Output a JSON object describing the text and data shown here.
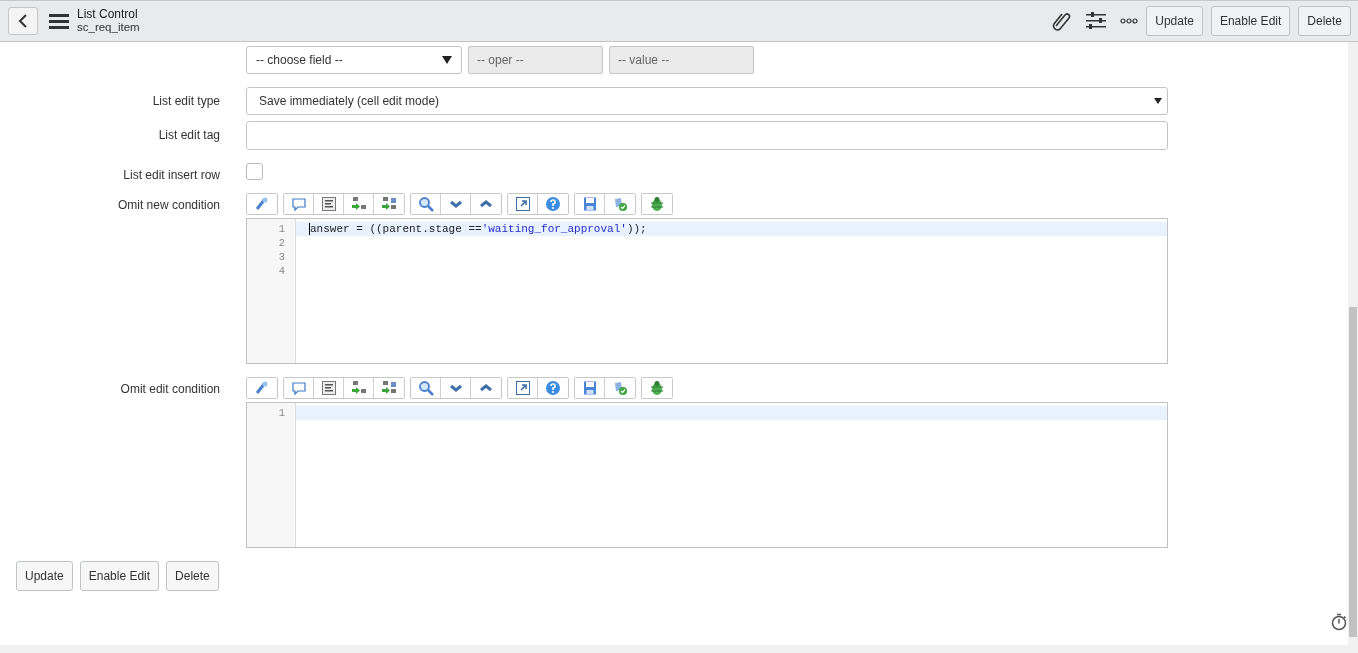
{
  "header": {
    "title": "List Control",
    "subtitle": "sc_req_item",
    "buttons": [
      "Update",
      "Enable Edit",
      "Delete"
    ]
  },
  "condition": {
    "field_placeholder": "-- choose field --",
    "oper_placeholder": "-- oper --",
    "value_placeholder": "-- value --"
  },
  "fields": [
    {
      "kind": "select",
      "label": "List edit type",
      "value": "Save immediately (cell edit mode)"
    },
    {
      "kind": "text",
      "label": "List edit tag"
    },
    {
      "kind": "checkbox",
      "label": "List edit insert row",
      "checked": false
    },
    {
      "kind": "script",
      "label": "Omit new condition",
      "lines": [
        {
          "number": "1",
          "active": true,
          "tokens": [
            {
              "kind": "plain",
              "text": "answer = ((parent.stage =="
            },
            {
              "kind": "string",
              "text": "'waiting_for_approval'"
            },
            {
              "kind": "plain",
              "text": "));"
            }
          ]
        },
        {
          "number": "2",
          "active": false
        },
        {
          "number": "3",
          "active": false
        },
        {
          "number": "4",
          "active": false
        }
      ]
    },
    {
      "kind": "script",
      "label": "Omit edit condition",
      "lines": [
        {
          "number": "1",
          "active": true
        }
      ]
    }
  ],
  "footer_buttons": [
    "Update",
    "Enable Edit",
    "Delete"
  ]
}
